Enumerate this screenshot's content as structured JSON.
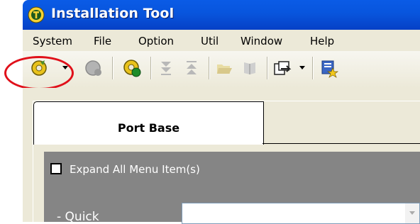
{
  "window": {
    "title": "Installation Tool",
    "icon": "app-gear-icon"
  },
  "menubar": {
    "items": [
      "System",
      "File",
      "Option",
      "Util",
      "Window",
      "Help"
    ]
  },
  "toolbar": {
    "buttons": [
      {
        "name": "connect",
        "icon": "connect-gear-icon",
        "has_dropdown": true,
        "enabled": true,
        "highlighted": true
      },
      {
        "name": "disconnect",
        "icon": "disconnect-gear-icon",
        "enabled": false
      },
      {
        "name": "refresh",
        "icon": "refresh-gear-icon",
        "enabled": true
      },
      {
        "name": "download",
        "icon": "download-icon",
        "enabled": false
      },
      {
        "name": "upload",
        "icon": "upload-icon",
        "enabled": false
      },
      {
        "name": "open",
        "icon": "folder-open-icon",
        "enabled": false
      },
      {
        "name": "book",
        "icon": "book-icon",
        "enabled": false
      },
      {
        "name": "export",
        "icon": "export-icon",
        "has_dropdown": true,
        "enabled": true
      },
      {
        "name": "wizard",
        "icon": "wizard-icon",
        "enabled": true
      }
    ],
    "highlight_color": "#e0101a"
  },
  "tabs": [
    {
      "label": "Port Base",
      "active": true
    }
  ],
  "panel": {
    "expand_all_label": "Expand All Menu Item(s)",
    "expand_all_checked": false,
    "quick_label": "- Quick",
    "quick_value": ""
  },
  "colors": {
    "titlebar": "#0855dd",
    "chrome": "#ece9d8",
    "panel": "#858585"
  }
}
